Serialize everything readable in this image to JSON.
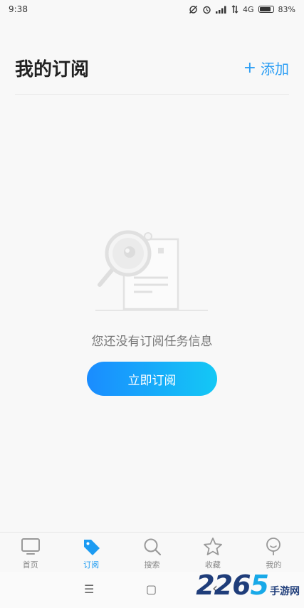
{
  "status_bar": {
    "time": "9:38",
    "network": "4G",
    "battery": "83%",
    "icons": [
      "sync-off-icon",
      "alarm-icon",
      "signal-icon",
      "data-arrows-icon",
      "battery-icon"
    ]
  },
  "header": {
    "title": "我的订阅",
    "add_label": "添加",
    "add_icon": "+"
  },
  "empty_state": {
    "illustration_icon": "search-document-icon",
    "message": "您还没有订阅任务信息",
    "button_label": "立即订阅"
  },
  "bottom_nav": {
    "items": [
      {
        "label": "首页",
        "icon": "tv-icon",
        "active": false
      },
      {
        "label": "订阅",
        "icon": "tag-icon",
        "active": true
      },
      {
        "label": "搜索",
        "icon": "search-icon",
        "active": false
      },
      {
        "label": "收藏",
        "icon": "star-icon",
        "active": false
      },
      {
        "label": "我的",
        "icon": "profile-icon",
        "active": false
      }
    ]
  },
  "system_nav": {
    "menu_glyph": "☰",
    "home_glyph": "▢",
    "back_glyph": "‹"
  },
  "watermark": {
    "number_a": "226",
    "number_b": "5",
    "text": "手游网"
  },
  "colors": {
    "accent": "#2a9df4",
    "button_start": "#1a8cff",
    "button_end": "#14c8f5",
    "background": "#f8f8f8"
  }
}
